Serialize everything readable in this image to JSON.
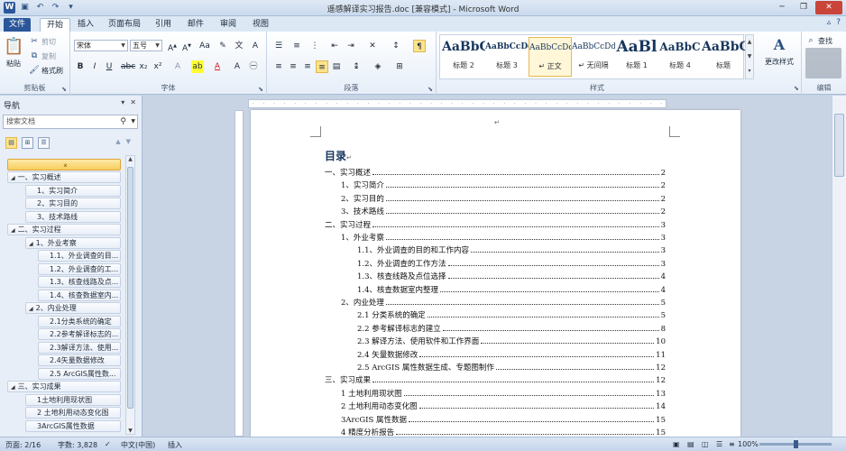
{
  "window": {
    "title": "遥感解译实习报告.doc [兼容模式] - Microsoft Word"
  },
  "tabs": [
    "文件",
    "开始",
    "插入",
    "页面布局",
    "引用",
    "邮件",
    "审阅",
    "视图"
  ],
  "ribbon": {
    "clipboard": {
      "paste": "粘贴",
      "cut": "剪切",
      "copy": "复制",
      "format_painter": "格式刷",
      "label": "剪贴板"
    },
    "font": {
      "name": "宋体",
      "size": "五号",
      "label": "字体"
    },
    "paragraph": {
      "label": "段落"
    },
    "styles": {
      "label": "样式",
      "items": [
        {
          "preview": "AaBbC",
          "name": "标题 2"
        },
        {
          "preview": "AaBbCcDd",
          "name": "标题 3"
        },
        {
          "preview": "AaBbCcDd",
          "name": "↵ 正文"
        },
        {
          "preview": "AaBbCcDd",
          "name": "↵ 无间隔"
        },
        {
          "preview": "AaBl",
          "name": "标题 1"
        },
        {
          "preview": "AaBbC",
          "name": "标题 4"
        },
        {
          "preview": "AaBbC",
          "name": "标题"
        }
      ],
      "change_styles": "更改样式"
    },
    "editing": {
      "find": "查找",
      "label": "编辑"
    }
  },
  "nav": {
    "title": "导航",
    "search_placeholder": "搜索文档",
    "items": [
      {
        "label": "一、实习概述",
        "level": 0,
        "tri": "◢"
      },
      {
        "label": "1、实习简介",
        "level": 1
      },
      {
        "label": "2、实习目的",
        "level": 1
      },
      {
        "label": "3、技术路线",
        "level": 1
      },
      {
        "label": "二、实习过程",
        "level": 0,
        "tri": "◢"
      },
      {
        "label": "1、外业考察",
        "level": 1,
        "tri": "◢"
      },
      {
        "label": "1.1、外业调查的目...",
        "level": 2
      },
      {
        "label": "1.2、外业调查的工...",
        "level": 2
      },
      {
        "label": "1.3、核查线路及点...",
        "level": 2
      },
      {
        "label": "1.4、核查数据室内...",
        "level": 2
      },
      {
        "label": "2、内业处理",
        "level": 1,
        "tri": "◢"
      },
      {
        "label": "2.1分类系统的确定",
        "level": 2
      },
      {
        "label": "2.2参考解译标志的...",
        "level": 2
      },
      {
        "label": "2.3解译方法、使用...",
        "level": 2
      },
      {
        "label": "2.4矢量数据修改",
        "level": 2
      },
      {
        "label": "2.5 ArcGIS属性数...",
        "level": 2
      },
      {
        "label": "三、实习成果",
        "level": 0,
        "tri": "◢"
      },
      {
        "label": "1土地利用现状图",
        "level": 1
      },
      {
        "label": "2 土地利用动态变化图",
        "level": 1
      },
      {
        "label": "3ArcGIS属性数据",
        "level": 1
      }
    ]
  },
  "document": {
    "toc_title": "目录",
    "entries": [
      {
        "text": "一、实习概述",
        "page": "2",
        "indent": 0
      },
      {
        "text": "1、实习简介",
        "page": "2",
        "indent": 1
      },
      {
        "text": "2、实习目的",
        "page": "2",
        "indent": 1
      },
      {
        "text": "3、技术路线",
        "page": "2",
        "indent": 1
      },
      {
        "text": "二、实习过程",
        "page": "3",
        "indent": 0
      },
      {
        "text": "1、外业考察",
        "page": "3",
        "indent": 1
      },
      {
        "text": "1.1、外业调查的目的和工作内容",
        "page": "3",
        "indent": 2
      },
      {
        "text": "1.2、外业调查的工作方法",
        "page": "3",
        "indent": 2
      },
      {
        "text": "1.3、核查线路及点位选择",
        "page": "4",
        "indent": 2
      },
      {
        "text": "1.4、核查数据室内整理",
        "page": "4",
        "indent": 2
      },
      {
        "text": "2、内业处理",
        "page": "5",
        "indent": 1
      },
      {
        "text": "2.1 分类系统的确定",
        "page": "5",
        "indent": 2
      },
      {
        "text": "2.2 参考解译标志的建立",
        "page": "8",
        "indent": 2
      },
      {
        "text": "2.3 解译方法、使用软件和工作界面",
        "page": "10",
        "indent": 2
      },
      {
        "text": "2.4 矢量数据修改",
        "page": "11",
        "indent": 2
      },
      {
        "text": "2.5 ArcGIS 属性数据生成、专题图制作",
        "page": "12",
        "indent": 2
      },
      {
        "text": "三、实习成果",
        "page": "12",
        "indent": 0
      },
      {
        "text": "1 土地利用现状图",
        "page": "13",
        "indent": 1
      },
      {
        "text": "2 土地利用动态变化图",
        "page": "14",
        "indent": 1
      },
      {
        "text": "3ArcGIS 属性数据",
        "page": "15",
        "indent": 1
      },
      {
        "text": "4 精度分析报告",
        "page": "15",
        "indent": 1
      }
    ]
  },
  "status": {
    "page": "页面: 2/16",
    "words": "字数: 3,828",
    "language": "中文(中国)",
    "mode": "插入",
    "zoom": "100%"
  }
}
